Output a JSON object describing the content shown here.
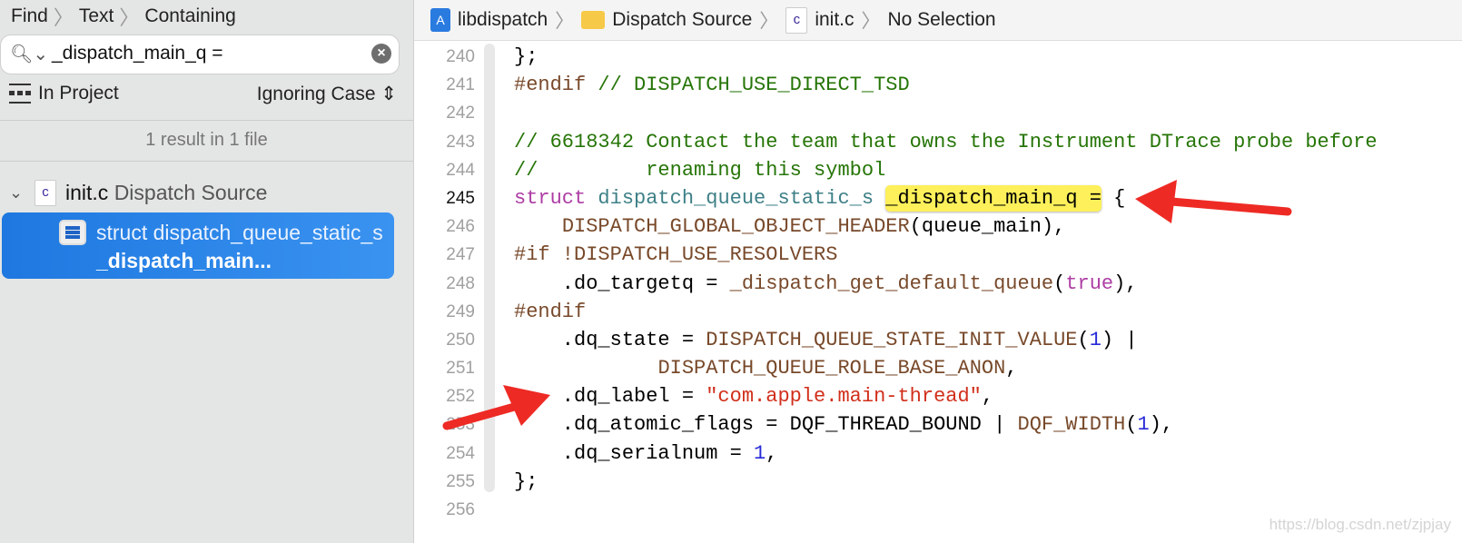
{
  "find": {
    "breadcrumbs": [
      "Find",
      "Text",
      "Containing"
    ],
    "query": "_dispatch_main_q =",
    "scope": "In Project",
    "case_mode": "Ignoring Case",
    "summary": "1 result in 1 file",
    "file": {
      "name": "init.c",
      "group": "Dispatch Source",
      "icon_letter": "c"
    },
    "result": {
      "prefix": "struct dispatch_queue_static_s ",
      "match": "_dispatch_main..."
    }
  },
  "jump_bar": {
    "project": "libdispatch",
    "folder": "Dispatch Source",
    "file": "init.c",
    "selection": "No Selection",
    "file_icon_letter": "c"
  },
  "editor": {
    "current_line": 245,
    "lines": [
      {
        "n": "240",
        "t": [
          [
            "};",
            ""
          ]
        ]
      },
      {
        "n": "241",
        "t": [
          [
            "#endif",
            "macro"
          ],
          [
            " // DISPATCH_USE_DIRECT_TSD",
            "cmt"
          ]
        ]
      },
      {
        "n": "242",
        "t": []
      },
      {
        "n": "243",
        "t": [
          [
            "// 6618342 Contact the team that owns the Instrument DTrace probe before",
            "cmt"
          ]
        ]
      },
      {
        "n": "244",
        "t": [
          [
            "//         renaming this symbol",
            "cmt"
          ]
        ]
      },
      {
        "n": "245",
        "t": [
          [
            "struct",
            "kw"
          ],
          [
            " ",
            ""
          ],
          [
            "dispatch_queue_static_s",
            "type"
          ],
          [
            " ",
            ""
          ],
          [
            "_dispatch_main_q =",
            "hl"
          ],
          [
            " {",
            ""
          ]
        ]
      },
      {
        "n": "246",
        "t": [
          [
            "    ",
            ""
          ],
          [
            "DISPATCH_GLOBAL_OBJECT_HEADER",
            "macro"
          ],
          [
            "(queue_main),",
            ""
          ]
        ]
      },
      {
        "n": "247",
        "t": [
          [
            "#if !DISPATCH_USE_RESOLVERS",
            "macro"
          ]
        ]
      },
      {
        "n": "248",
        "t": [
          [
            "    .do_targetq = ",
            ""
          ],
          [
            "_dispatch_get_default_queue",
            "macro"
          ],
          [
            "(",
            ""
          ],
          [
            "true",
            "kw"
          ],
          [
            "),",
            ""
          ]
        ]
      },
      {
        "n": "249",
        "t": [
          [
            "#endif",
            "macro"
          ]
        ]
      },
      {
        "n": "250",
        "t": [
          [
            "    .dq_state = ",
            ""
          ],
          [
            "DISPATCH_QUEUE_STATE_INIT_VALUE",
            "macro"
          ],
          [
            "(",
            ""
          ],
          [
            "1",
            "num"
          ],
          [
            ") |",
            ""
          ]
        ]
      },
      {
        "n": "251",
        "t": [
          [
            "            ",
            ""
          ],
          [
            "DISPATCH_QUEUE_ROLE_BASE_ANON",
            "macro"
          ],
          [
            ",",
            ""
          ]
        ]
      },
      {
        "n": "252",
        "t": [
          [
            "    .dq_label = ",
            ""
          ],
          [
            "\"com.apple.main-thread\"",
            "str"
          ],
          [
            ",",
            ""
          ]
        ]
      },
      {
        "n": "253",
        "t": [
          [
            "    .dq_atomic_flags = DQF_THREAD_BOUND | ",
            ""
          ],
          [
            "DQF_WIDTH",
            "macro"
          ],
          [
            "(",
            ""
          ],
          [
            "1",
            "num"
          ],
          [
            "),",
            ""
          ]
        ]
      },
      {
        "n": "254",
        "t": [
          [
            "    .dq_serialnum = ",
            ""
          ],
          [
            "1",
            "num"
          ],
          [
            ",",
            ""
          ]
        ]
      },
      {
        "n": "255",
        "t": [
          [
            "};",
            ""
          ]
        ]
      },
      {
        "n": "256",
        "t": []
      }
    ]
  },
  "watermark": "https://blog.csdn.net/zjpjay",
  "colors": {
    "selection": "#1e78e0",
    "highlight": "#fdf05a",
    "arrow": "#ee2a24",
    "keyword": "#ad3da4",
    "comment": "#267507",
    "string": "#d12f1b",
    "macro": "#78492a",
    "number": "#272ad8",
    "type": "#3e8087"
  }
}
